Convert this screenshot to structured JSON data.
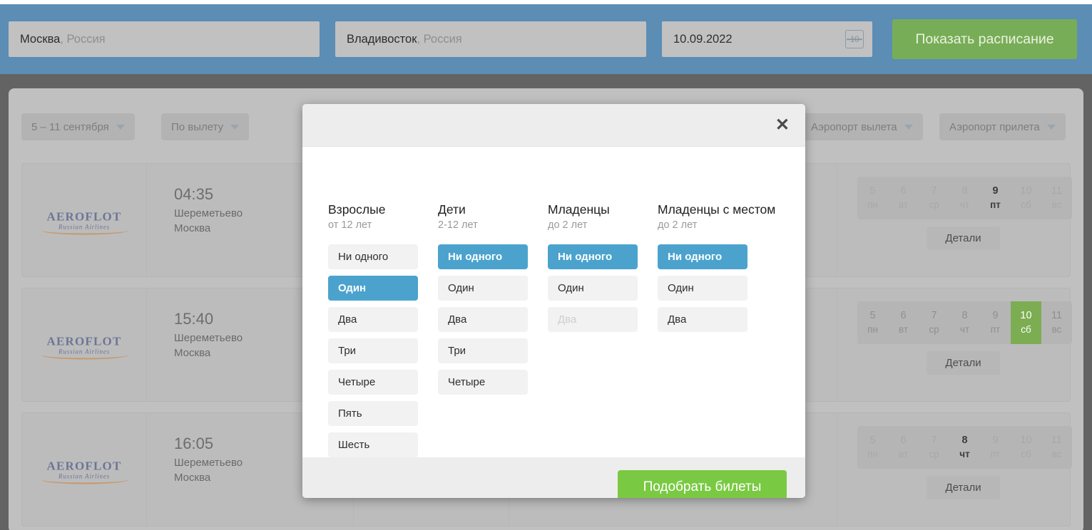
{
  "search": {
    "origin_city": "Москва",
    "origin_country": ", Россия",
    "destination_city": "Владивосток",
    "destination_country": ", Россия",
    "date_value": "10.09.2022",
    "calendar_icon_day": "10",
    "submit_label": "Показать расписание",
    "submit_color": "#78ad57"
  },
  "filters": [
    {
      "label": "5 – 11 сентября"
    },
    {
      "label": "По вылету"
    },
    {
      "label": "Аэропорт вылета"
    },
    {
      "label": "Аэропорт прилета"
    }
  ],
  "flights": [
    {
      "airline": "AEROFLOT",
      "airline_sub": "Russian Airlines",
      "time": "04:35",
      "airport": "Шереметьево",
      "city": "Москва",
      "details_label": "Детали",
      "days": [
        {
          "num": "5",
          "dow": "пн",
          "state": "dim"
        },
        {
          "num": "6",
          "dow": "вт",
          "state": "dim"
        },
        {
          "num": "7",
          "dow": "ср",
          "state": "dim"
        },
        {
          "num": "8",
          "dow": "чт",
          "state": "dim"
        },
        {
          "num": "9",
          "dow": "пт",
          "state": "on"
        },
        {
          "num": "10",
          "dow": "сб",
          "state": "dim"
        },
        {
          "num": "11",
          "dow": "вс",
          "state": "dim"
        }
      ]
    },
    {
      "airline": "AEROFLOT",
      "airline_sub": "Russian Airlines",
      "time": "15:40",
      "airport": "Шереметьево",
      "city": "Москва",
      "details_label": "Детали",
      "days": [
        {
          "num": "5",
          "dow": "пн",
          "state": "dim2"
        },
        {
          "num": "6",
          "dow": "вт",
          "state": "dim2"
        },
        {
          "num": "7",
          "dow": "ср",
          "state": "dim2"
        },
        {
          "num": "8",
          "dow": "чт",
          "state": "dim2"
        },
        {
          "num": "9",
          "dow": "пт",
          "state": "dim2"
        },
        {
          "num": "10",
          "dow": "сб",
          "state": "sel"
        },
        {
          "num": "11",
          "dow": "вс",
          "state": "dim2"
        }
      ]
    },
    {
      "airline": "AEROFLOT",
      "airline_sub": "Russian Airlines",
      "time": "16:05",
      "airport": "Шереметьево",
      "city": "Москва",
      "details_label": "Детали",
      "days": [
        {
          "num": "5",
          "dow": "пн",
          "state": "dim"
        },
        {
          "num": "6",
          "dow": "вт",
          "state": "dim"
        },
        {
          "num": "7",
          "dow": "ср",
          "state": "dim"
        },
        {
          "num": "8",
          "dow": "чт",
          "state": "on"
        },
        {
          "num": "9",
          "dow": "пт",
          "state": "dim"
        },
        {
          "num": "10",
          "dow": "сб",
          "state": "dim"
        },
        {
          "num": "11",
          "dow": "вс",
          "state": "dim"
        }
      ]
    }
  ],
  "modal": {
    "close_label": "✕",
    "accent_color": "#4ba3cd",
    "submit_label": "Подобрать билеты",
    "submit_color": "#7ac943",
    "columns": [
      {
        "title": "Взрослые",
        "subtitle": "от 12 лет",
        "options": [
          {
            "label": "Ни одного",
            "state": "normal"
          },
          {
            "label": "Один",
            "state": "active"
          },
          {
            "label": "Два",
            "state": "normal"
          },
          {
            "label": "Три",
            "state": "normal"
          },
          {
            "label": "Четыре",
            "state": "normal"
          },
          {
            "label": "Пять",
            "state": "normal"
          },
          {
            "label": "Шесть",
            "state": "normal"
          }
        ]
      },
      {
        "title": "Дети",
        "subtitle": "2-12 лет",
        "options": [
          {
            "label": "Ни одного",
            "state": "active"
          },
          {
            "label": "Один",
            "state": "normal"
          },
          {
            "label": "Два",
            "state": "normal"
          },
          {
            "label": "Три",
            "state": "normal"
          },
          {
            "label": "Четыре",
            "state": "normal"
          }
        ]
      },
      {
        "title": "Младенцы",
        "subtitle": "до 2 лет",
        "options": [
          {
            "label": "Ни одного",
            "state": "active"
          },
          {
            "label": "Один",
            "state": "normal"
          },
          {
            "label": "Два",
            "state": "disabled"
          }
        ]
      },
      {
        "title": "Младенцы с местом",
        "subtitle": "до 2 лет",
        "options": [
          {
            "label": "Ни одного",
            "state": "active"
          },
          {
            "label": "Один",
            "state": "normal"
          },
          {
            "label": "Два",
            "state": "normal"
          }
        ]
      }
    ]
  }
}
